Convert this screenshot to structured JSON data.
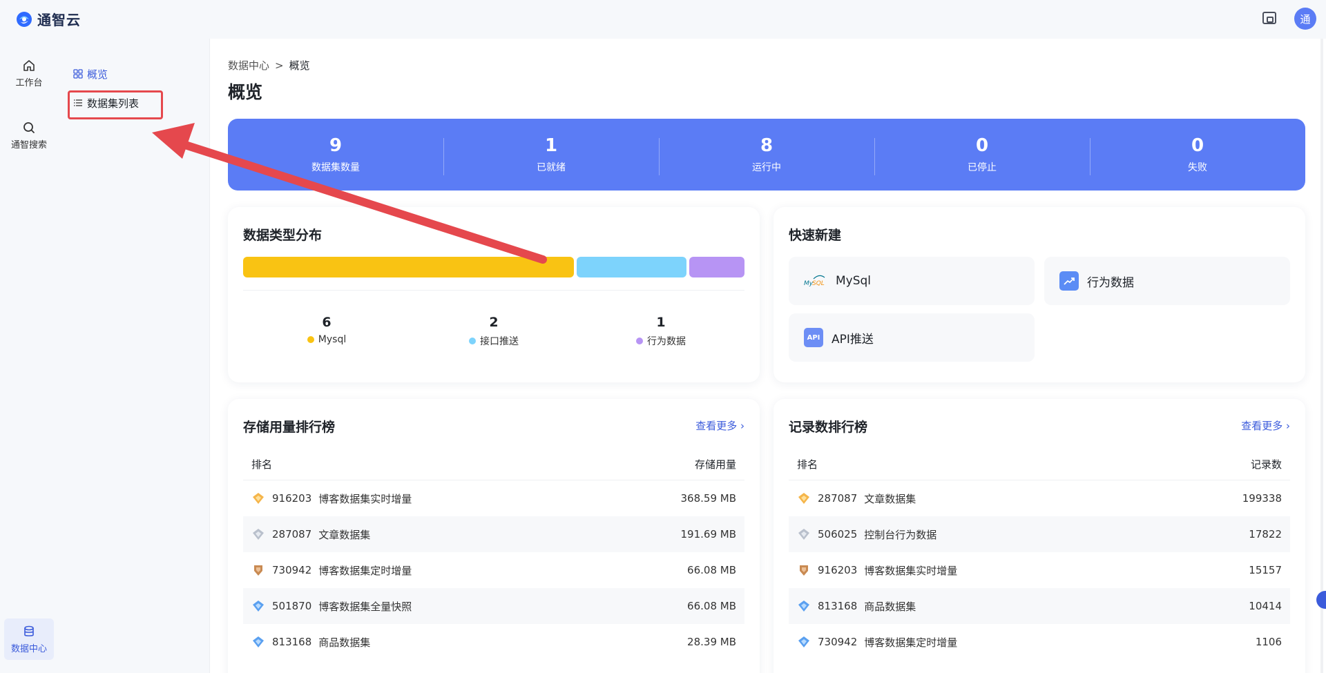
{
  "app": {
    "name": "通智云",
    "avatar_text": "通"
  },
  "rail": [
    {
      "label": "工作台",
      "icon": "home-icon"
    },
    {
      "label": "通智搜索",
      "icon": "search-icon"
    },
    {
      "label": "数据中心",
      "icon": "database-icon",
      "active": true
    }
  ],
  "submenu": [
    {
      "label": "概览",
      "icon": "grid-icon",
      "active": true
    },
    {
      "label": "数据集列表",
      "icon": "list-icon",
      "highlighted": true
    }
  ],
  "breadcrumb": {
    "parent": "数据中心",
    "separator": ">",
    "current": "概览"
  },
  "page_title": "概览",
  "stats": [
    {
      "value": "9",
      "label": "数据集数量"
    },
    {
      "value": "1",
      "label": "已就绪"
    },
    {
      "value": "8",
      "label": "运行中"
    },
    {
      "value": "0",
      "label": "已停止"
    },
    {
      "value": "0",
      "label": "失败"
    }
  ],
  "distribution": {
    "title": "数据类型分布",
    "items": [
      {
        "count": "6",
        "name": "Mysql",
        "value": 6,
        "color": "#f9c313"
      },
      {
        "count": "2",
        "name": "接口推送",
        "value": 2,
        "color": "#7dd3fc"
      },
      {
        "count": "1",
        "name": "行为数据",
        "value": 1,
        "color": "#b794f4"
      }
    ]
  },
  "quick_create": {
    "title": "快速新建",
    "items": [
      {
        "label": "MySql",
        "icon": "mysql-icon"
      },
      {
        "label": "行为数据",
        "icon": "behavior-chart-icon"
      },
      {
        "label": "API推送",
        "icon": "api-icon",
        "icon_text": "API"
      }
    ]
  },
  "storage_rank": {
    "title": "存储用量排行榜",
    "more": "查看更多",
    "col_rank": "排名",
    "col_value": "存储用量",
    "rows": [
      {
        "id": "916203",
        "name": "博客数据集实时增量",
        "value": "368.59 MB"
      },
      {
        "id": "287087",
        "name": "文章数据集",
        "value": "191.69 MB"
      },
      {
        "id": "730942",
        "name": "博客数据集定时增量",
        "value": "66.08 MB"
      },
      {
        "id": "501870",
        "name": "博客数据集全量快照",
        "value": "66.08 MB"
      },
      {
        "id": "813168",
        "name": "商品数据集",
        "value": "28.39 MB"
      }
    ]
  },
  "record_rank": {
    "title": "记录数排行榜",
    "more": "查看更多",
    "col_rank": "排名",
    "col_value": "记录数",
    "rows": [
      {
        "id": "287087",
        "name": "文章数据集",
        "value": "199338"
      },
      {
        "id": "506025",
        "name": "控制台行为数据",
        "value": "17822"
      },
      {
        "id": "916203",
        "name": "博客数据集实时增量",
        "value": "15157"
      },
      {
        "id": "813168",
        "name": "商品数据集",
        "value": "10414"
      },
      {
        "id": "730942",
        "name": "博客数据集定时增量",
        "value": "1106"
      }
    ]
  },
  "colors": {
    "accent": "#5b7cf5",
    "link": "#3b5bdb",
    "annotation": "#e5484d"
  }
}
